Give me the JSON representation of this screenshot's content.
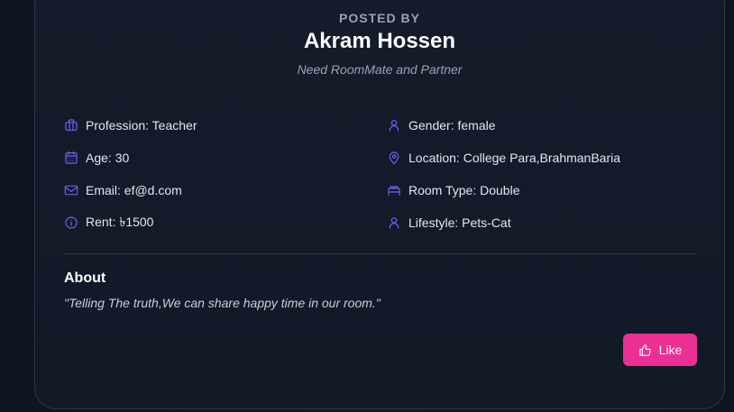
{
  "colors": {
    "accent": "#6d63f0",
    "like_button": "#ec2f92",
    "background": "#121a28"
  },
  "poster": {
    "posted_by_label": "POSTED BY",
    "name": "Akram Hossen",
    "tagline": "Need RoomMate and Partner"
  },
  "details": {
    "profession": "Profession: Teacher",
    "age": "Age: 30",
    "email": "Email: ef@d.com",
    "rent": "Rent: ৳1500",
    "gender": "Gender: female",
    "location": "Location: College Para,BrahmanBaria",
    "room_type": "Room Type: Double",
    "lifestyle": "Lifestyle: Pets-Cat"
  },
  "about": {
    "heading": "About",
    "text": "\"Telling The truth,We can share happy time in our room.\""
  },
  "actions": {
    "like_label": "Like"
  },
  "icons": {
    "profession": "briefcase-icon",
    "age": "calendar-icon",
    "email": "mail-icon",
    "rent": "info-icon",
    "gender": "user-icon",
    "location": "map-pin-icon",
    "room_type": "bed-icon",
    "lifestyle": "user-icon",
    "like": "thumbs-up-icon"
  }
}
